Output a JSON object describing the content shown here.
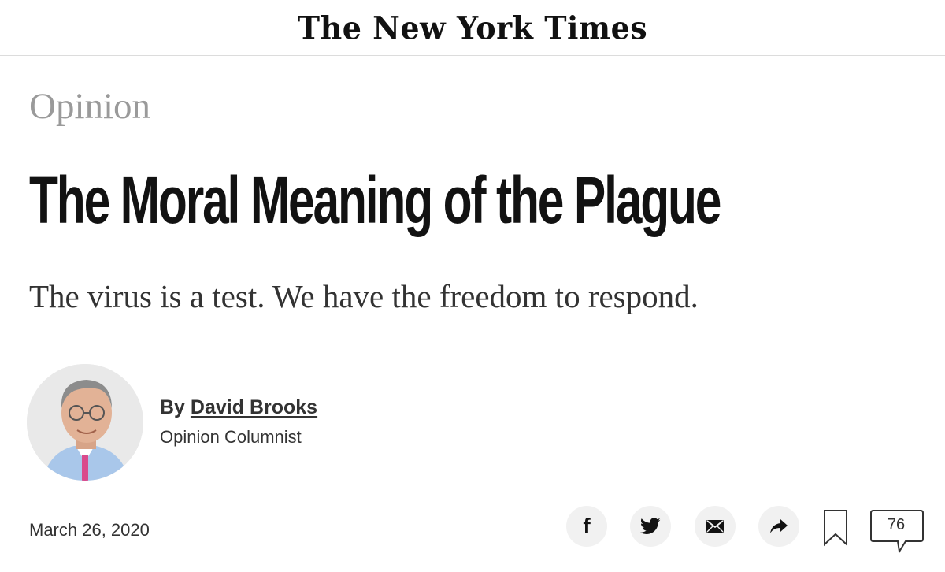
{
  "masthead": {
    "logo_text": "The New York Times"
  },
  "article": {
    "section": "Opinion",
    "headline": "The Moral Meaning of the Plague",
    "summary": "The virus is a test. We have the freedom to respond.",
    "byline_prefix": "By",
    "author": "David Brooks",
    "author_role": "Opinion Columnist",
    "date": "March 26, 2020"
  },
  "toolbar": {
    "facebook_icon": "f",
    "comment_count": "76"
  },
  "icons": {
    "facebook": "facebook-icon",
    "twitter": "twitter-icon",
    "email": "email-icon",
    "share": "share-arrow-icon",
    "save": "bookmark-icon",
    "comments": "comment-bubble-icon"
  },
  "colors": {
    "text": "#121212",
    "section": "#9a9a9a",
    "button_bg": "#f1f1f1",
    "divider": "#dcdcdc"
  }
}
